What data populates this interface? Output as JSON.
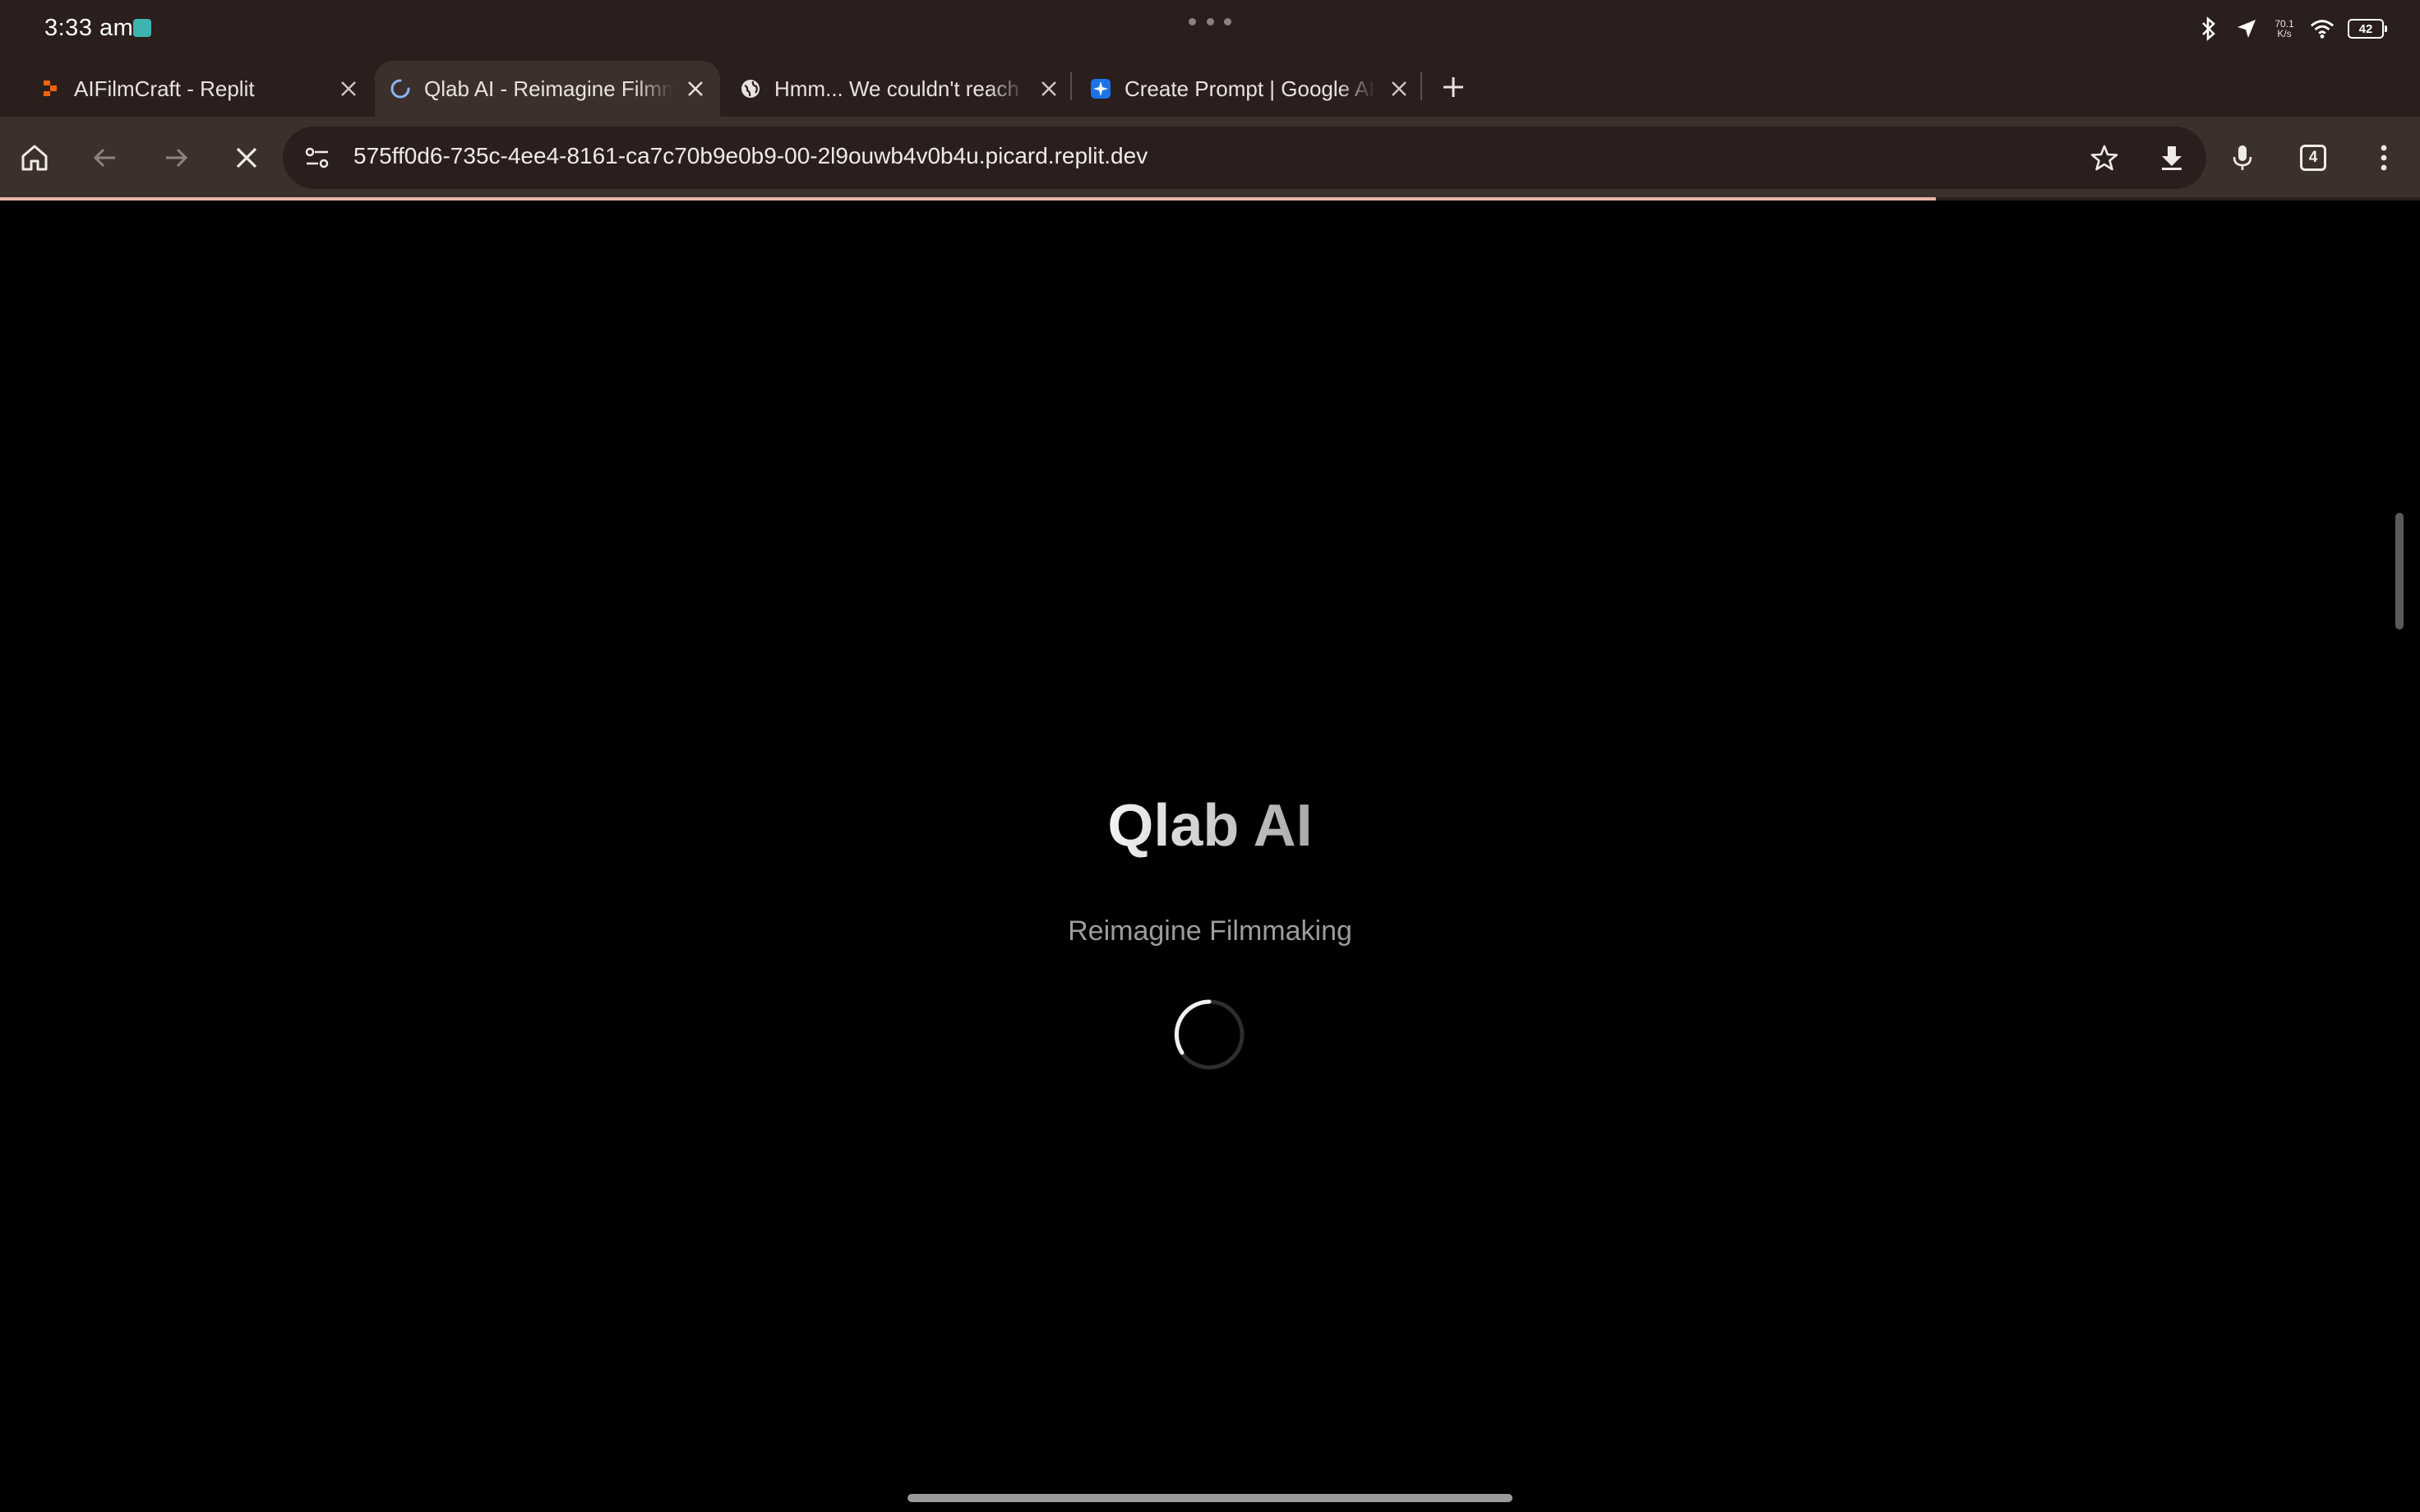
{
  "status_bar": {
    "time": "3:33 am",
    "net_speed_value": "70.1",
    "net_speed_unit": "K/s",
    "battery": "42",
    "icons": [
      "bluetooth-icon",
      "location-icon",
      "wifi-icon",
      "battery-icon"
    ]
  },
  "tabs": [
    {
      "title": "AIFilmCraft - Replit",
      "favicon": "replit-icon",
      "active": false
    },
    {
      "title": "Qlab AI - Reimagine Filmmaking",
      "favicon": "loading-spinner-icon",
      "active": true
    },
    {
      "title": "Hmm... We couldn't reach this page",
      "favicon": "globe-icon",
      "active": false
    },
    {
      "title": "Create Prompt | Google AI Studio",
      "favicon": "google-ai-studio-icon",
      "active": false
    }
  ],
  "toolbar": {
    "url": "575ff0d6-735c-4ee4-8161-ca7c70b9e0b9-00-2l9ouwb4v0b4u.picard.replit.dev",
    "tab_count": "4",
    "page_load_progress": 0.8
  },
  "page": {
    "title": "Qlab AI",
    "subtitle": "Reimagine Filmmaking"
  },
  "colors": {
    "chrome_bg": "#2a1f1d",
    "toolbar_bg": "#3c302d",
    "progress": "#e9b7a6",
    "page_bg": "#000000"
  }
}
